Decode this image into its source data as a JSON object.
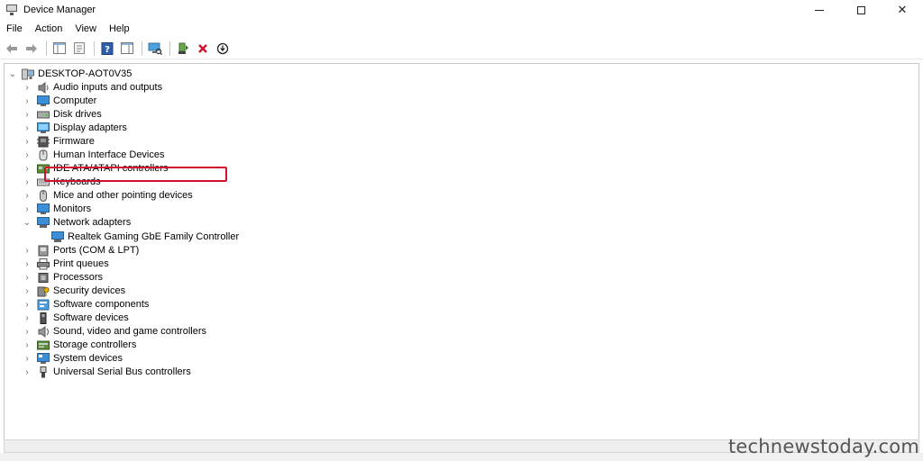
{
  "window": {
    "title": "Device Manager"
  },
  "menu": [
    {
      "label": "File"
    },
    {
      "label": "Action"
    },
    {
      "label": "View"
    },
    {
      "label": "Help"
    }
  ],
  "toolbar": [
    {
      "icon": "back-arrow-icon"
    },
    {
      "icon": "forward-arrow-icon"
    },
    {
      "icon": "show-hide-console-tree-icon"
    },
    {
      "icon": "properties-icon"
    },
    {
      "icon": "help-icon"
    },
    {
      "icon": "show-action-pane-icon"
    },
    {
      "icon": "scan-hardware-icon"
    },
    {
      "icon": "update-driver-icon"
    },
    {
      "icon": "uninstall-device-icon"
    },
    {
      "icon": "disable-device-icon"
    }
  ],
  "tree": {
    "root": "DESKTOP-AOT0V35",
    "categories": [
      {
        "label": "Audio inputs and outputs",
        "icon": "speaker-icon",
        "expanded": false
      },
      {
        "label": "Computer",
        "icon": "computer-icon",
        "expanded": false
      },
      {
        "label": "Disk drives",
        "icon": "disk-drive-icon",
        "expanded": false
      },
      {
        "label": "Display adapters",
        "icon": "display-adapter-icon",
        "expanded": false
      },
      {
        "label": "Firmware",
        "icon": "firmware-icon",
        "expanded": false
      },
      {
        "label": "Human Interface Devices",
        "icon": "hid-icon",
        "expanded": false
      },
      {
        "label": "IDE ATA/ATAPI controllers",
        "icon": "ide-controller-icon",
        "expanded": false
      },
      {
        "label": "Keyboards",
        "icon": "keyboard-icon",
        "expanded": false
      },
      {
        "label": "Mice and other pointing devices",
        "icon": "mouse-icon",
        "expanded": false
      },
      {
        "label": "Monitors",
        "icon": "monitor-icon",
        "expanded": false
      },
      {
        "label": "Network adapters",
        "icon": "network-adapter-icon",
        "expanded": true,
        "children": [
          {
            "label": "Realtek Gaming GbE Family Controller",
            "icon": "network-adapter-icon"
          }
        ]
      },
      {
        "label": "Ports (COM & LPT)",
        "icon": "port-icon",
        "expanded": false
      },
      {
        "label": "Print queues",
        "icon": "printer-icon",
        "expanded": false
      },
      {
        "label": "Processors",
        "icon": "processor-icon",
        "expanded": false
      },
      {
        "label": "Security devices",
        "icon": "security-device-icon",
        "expanded": false
      },
      {
        "label": "Software components",
        "icon": "software-component-icon",
        "expanded": false
      },
      {
        "label": "Software devices",
        "icon": "software-device-icon",
        "expanded": false
      },
      {
        "label": "Sound, video and game controllers",
        "icon": "sound-controller-icon",
        "expanded": false
      },
      {
        "label": "Storage controllers",
        "icon": "storage-controller-icon",
        "expanded": false
      },
      {
        "label": "System devices",
        "icon": "system-device-icon",
        "expanded": false
      },
      {
        "label": "Universal Serial Bus controllers",
        "icon": "usb-icon",
        "expanded": false
      }
    ]
  },
  "colors": {
    "highlight": "#d0122c",
    "accent": "#3c8fd6"
  },
  "watermark": "technewstoday.com"
}
